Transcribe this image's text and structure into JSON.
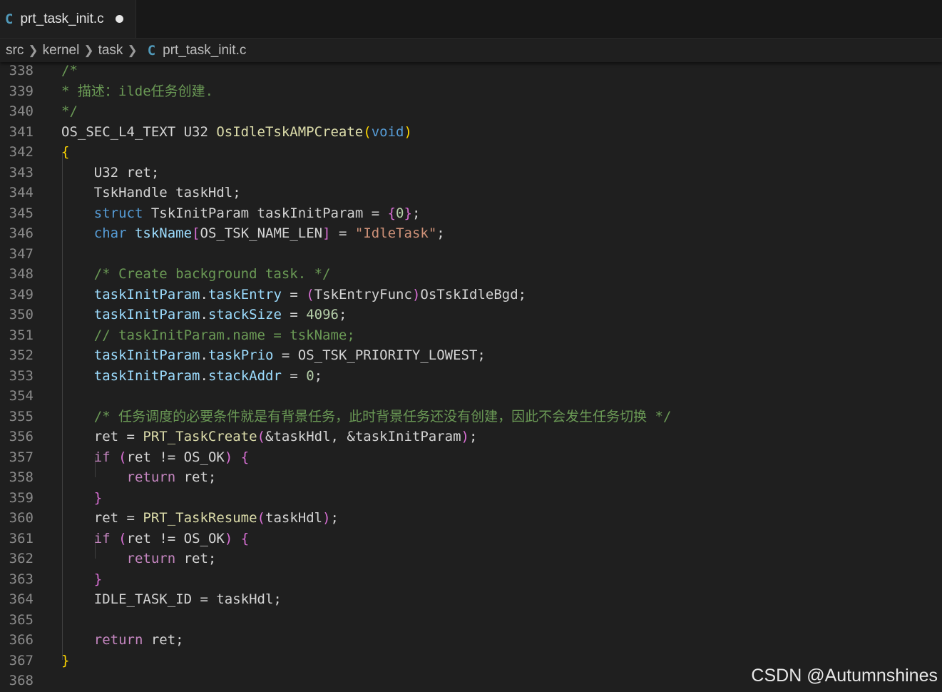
{
  "tab": {
    "lang_icon": "C",
    "filename": "prt_task_init.c",
    "modified": true
  },
  "breadcrumb": {
    "items": [
      "src",
      "kernel",
      "task"
    ],
    "lang_icon": "C",
    "file": "prt_task_init.c"
  },
  "colors": {
    "comment": "#6a9955",
    "keyword": "#569cd6",
    "function": "#dcdcaa",
    "string": "#ce9178",
    "number": "#b5cea8",
    "control": "#c586c0",
    "variable": "#9cdcfe",
    "bracket1": "#ffd700",
    "bracket2": "#da70d6"
  },
  "lines": [
    {
      "num": "338",
      "tokens": [
        [
          "c",
          "/*"
        ]
      ]
    },
    {
      "num": "339",
      "tokens": [
        [
          "c",
          "* 描述：ilde任务创建."
        ]
      ]
    },
    {
      "num": "340",
      "tokens": [
        [
          "c",
          "*/"
        ]
      ]
    },
    {
      "num": "341",
      "tokens": [
        [
          "d",
          "OS_SEC_L4_TEXT U32 "
        ],
        [
          "f",
          "OsIdleTskAMPCreate"
        ],
        [
          "y",
          "("
        ],
        [
          "k",
          "void"
        ],
        [
          "y",
          ")"
        ]
      ]
    },
    {
      "num": "342",
      "tokens": [
        [
          "y",
          "{"
        ]
      ]
    },
    {
      "num": "343",
      "tokens": [
        [
          "d",
          "    U32 ret;"
        ]
      ]
    },
    {
      "num": "344",
      "tokens": [
        [
          "d",
          "    TskHandle taskHdl;"
        ]
      ]
    },
    {
      "num": "345",
      "tokens": [
        [
          "d",
          "    "
        ],
        [
          "k",
          "struct"
        ],
        [
          "d",
          " TskInitParam taskInitParam = "
        ],
        [
          "m",
          "{"
        ],
        [
          "n",
          "0"
        ],
        [
          "m",
          "}"
        ],
        [
          "d",
          ";"
        ]
      ]
    },
    {
      "num": "346",
      "tokens": [
        [
          "d",
          "    "
        ],
        [
          "k",
          "char"
        ],
        [
          "d",
          " "
        ],
        [
          "v",
          "tskName"
        ],
        [
          "m",
          "["
        ],
        [
          "d",
          "OS_TSK_NAME_LEN"
        ],
        [
          "m",
          "]"
        ],
        [
          "d",
          " = "
        ],
        [
          "s",
          "\"IdleTask\""
        ],
        [
          "d",
          ";"
        ]
      ]
    },
    {
      "num": "347",
      "tokens": []
    },
    {
      "num": "348",
      "tokens": [
        [
          "d",
          "    "
        ],
        [
          "c",
          "/* Create background task. */"
        ]
      ]
    },
    {
      "num": "349",
      "tokens": [
        [
          "d",
          "    "
        ],
        [
          "v",
          "taskInitParam"
        ],
        [
          "d",
          "."
        ],
        [
          "v",
          "taskEntry"
        ],
        [
          "d",
          " = "
        ],
        [
          "m",
          "("
        ],
        [
          "d",
          "TskEntryFunc"
        ],
        [
          "m",
          ")"
        ],
        [
          "d",
          "OsTskIdleBgd;"
        ]
      ]
    },
    {
      "num": "350",
      "tokens": [
        [
          "d",
          "    "
        ],
        [
          "v",
          "taskInitParam"
        ],
        [
          "d",
          "."
        ],
        [
          "v",
          "stackSize"
        ],
        [
          "d",
          " = "
        ],
        [
          "n",
          "4096"
        ],
        [
          "d",
          ";"
        ]
      ]
    },
    {
      "num": "351",
      "tokens": [
        [
          "d",
          "    "
        ],
        [
          "c",
          "// taskInitParam.name = tskName;"
        ]
      ]
    },
    {
      "num": "352",
      "tokens": [
        [
          "d",
          "    "
        ],
        [
          "v",
          "taskInitParam"
        ],
        [
          "d",
          "."
        ],
        [
          "v",
          "taskPrio"
        ],
        [
          "d",
          " = OS_TSK_PRIORITY_LOWEST;"
        ]
      ]
    },
    {
      "num": "353",
      "tokens": [
        [
          "d",
          "    "
        ],
        [
          "v",
          "taskInitParam"
        ],
        [
          "d",
          "."
        ],
        [
          "v",
          "stackAddr"
        ],
        [
          "d",
          " = "
        ],
        [
          "n",
          "0"
        ],
        [
          "d",
          ";"
        ]
      ]
    },
    {
      "num": "354",
      "tokens": []
    },
    {
      "num": "355",
      "tokens": [
        [
          "d",
          "    "
        ],
        [
          "c",
          "/* 任务调度的必要条件就是有背景任务，此时背景任务还没有创建，因此不会发生任务切换 */"
        ]
      ]
    },
    {
      "num": "356",
      "tokens": [
        [
          "d",
          "    ret = "
        ],
        [
          "f",
          "PRT_TaskCreate"
        ],
        [
          "m",
          "("
        ],
        [
          "d",
          "&taskHdl, &taskInitParam"
        ],
        [
          "m",
          ")"
        ],
        [
          "d",
          ";"
        ]
      ]
    },
    {
      "num": "357",
      "tokens": [
        [
          "d",
          "    "
        ],
        [
          "p",
          "if"
        ],
        [
          "d",
          " "
        ],
        [
          "m",
          "("
        ],
        [
          "d",
          "ret != OS_OK"
        ],
        [
          "m",
          ")"
        ],
        [
          "d",
          " "
        ],
        [
          "m",
          "{"
        ]
      ]
    },
    {
      "num": "358",
      "tokens": [
        [
          "d",
          "        "
        ],
        [
          "p",
          "return"
        ],
        [
          "d",
          " ret;"
        ]
      ]
    },
    {
      "num": "359",
      "tokens": [
        [
          "d",
          "    "
        ],
        [
          "m",
          "}"
        ]
      ]
    },
    {
      "num": "360",
      "tokens": [
        [
          "d",
          "    ret = "
        ],
        [
          "f",
          "PRT_TaskResume"
        ],
        [
          "m",
          "("
        ],
        [
          "d",
          "taskHdl"
        ],
        [
          "m",
          ")"
        ],
        [
          "d",
          ";"
        ]
      ]
    },
    {
      "num": "361",
      "tokens": [
        [
          "d",
          "    "
        ],
        [
          "p",
          "if"
        ],
        [
          "d",
          " "
        ],
        [
          "m",
          "("
        ],
        [
          "d",
          "ret != OS_OK"
        ],
        [
          "m",
          ")"
        ],
        [
          "d",
          " "
        ],
        [
          "m",
          "{"
        ]
      ]
    },
    {
      "num": "362",
      "tokens": [
        [
          "d",
          "        "
        ],
        [
          "p",
          "return"
        ],
        [
          "d",
          " ret;"
        ]
      ]
    },
    {
      "num": "363",
      "tokens": [
        [
          "d",
          "    "
        ],
        [
          "m",
          "}"
        ]
      ]
    },
    {
      "num": "364",
      "tokens": [
        [
          "d",
          "    IDLE_TASK_ID = taskHdl;"
        ]
      ]
    },
    {
      "num": "365",
      "tokens": []
    },
    {
      "num": "366",
      "tokens": [
        [
          "d",
          "    "
        ],
        [
          "p",
          "return"
        ],
        [
          "d",
          " ret;"
        ]
      ]
    },
    {
      "num": "367",
      "tokens": [
        [
          "y",
          "}"
        ]
      ]
    },
    {
      "num": "368",
      "tokens": []
    }
  ],
  "watermark": "CSDN @Autumnshines"
}
